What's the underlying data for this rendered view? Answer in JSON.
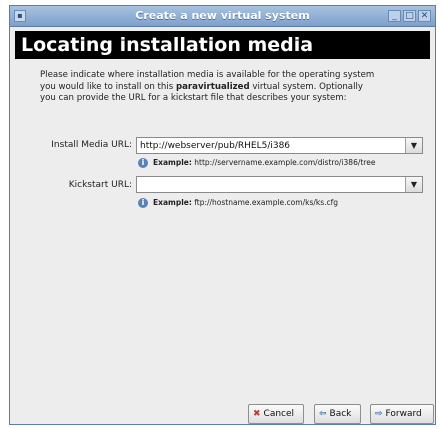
{
  "window": {
    "title": "Create a new virtual system",
    "controls": [
      "minimize-icon",
      "maximize-icon",
      "close-icon"
    ]
  },
  "banner": {
    "title": "Locating installation media"
  },
  "intro": {
    "part1": "Please indicate where installation media is available for the operating system you would like to install on this ",
    "emphasis": "paravirtualized",
    "part2": " virtual system. Optionally you can provide the URL for a kickstart file that describes your system:"
  },
  "install_media": {
    "label": "Install Media URL:",
    "value": "http://webserver/pub/RHEL5/i386",
    "hint_label": "Example:",
    "hint_text": " http://servername.example.com/distro/i386/tree"
  },
  "kickstart": {
    "label": "Kickstart URL:",
    "value": "",
    "hint_label": "Example:",
    "hint_text": " ftp://hostname.example.com/ks/ks.cfg"
  },
  "buttons": {
    "cancel": "Cancel",
    "back": "Back",
    "forward": "Forward"
  },
  "colors": {
    "titlebar": "#7da0cb",
    "banner_bg": "#000000",
    "banner_text": "#ffffff",
    "info_icon": "#5b82b7"
  }
}
